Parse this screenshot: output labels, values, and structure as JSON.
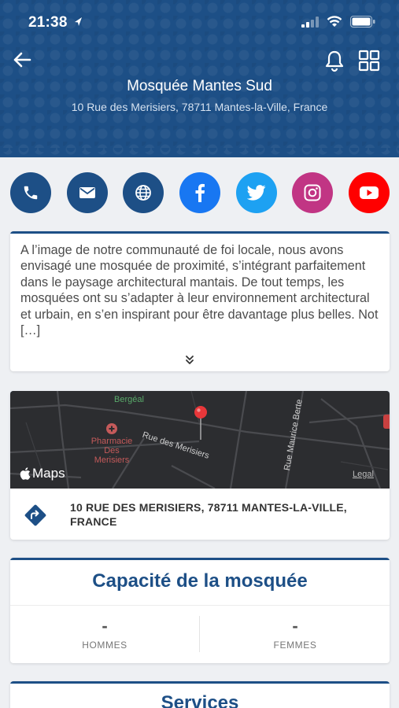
{
  "status": {
    "time": "21:38"
  },
  "header": {
    "title": "Mosquée Mantes Sud",
    "address": "10 Rue des Merisiers, 78711 Mantes-la-Ville, France"
  },
  "social": [
    {
      "name": "phone",
      "color": "#1d4f86"
    },
    {
      "name": "email",
      "color": "#1d4f86"
    },
    {
      "name": "website",
      "color": "#1d4f86"
    },
    {
      "name": "facebook",
      "color": "#1877f2"
    },
    {
      "name": "twitter",
      "color": "#1da1f2"
    },
    {
      "name": "instagram",
      "color": "#c13584"
    },
    {
      "name": "youtube",
      "color": "#ff0000"
    }
  ],
  "description": {
    "text": "A l’image de notre communauté de foi locale, nous avons envisagé une mosquée de proximité, s’intégrant parfaitement dans le paysage architectural mantais. De tout temps, les mosquées ont su s’adapter à leur environnement architectural et urbain, en s’en inspirant pour être davantage plus belles. Not […]"
  },
  "map": {
    "labels": {
      "street1": "Rue des Merisiers",
      "street2": "Rue Maurice Berte",
      "place1": "Bergéal",
      "place2_l1": "Pharmacie",
      "place2_l2": "Des",
      "place2_l3": "Merisiers",
      "maps_logo": "Maps",
      "legal": "Legal"
    },
    "address": "10 RUE DES MERISIERS, 78711 MANTES-LA-VILLE, FRANCE"
  },
  "capacity": {
    "title": "Capacité de la mosquée",
    "men_value": "-",
    "men_label": "HOMMES",
    "women_value": "-",
    "women_label": "FEMMES"
  },
  "services": {
    "title": "Services"
  }
}
